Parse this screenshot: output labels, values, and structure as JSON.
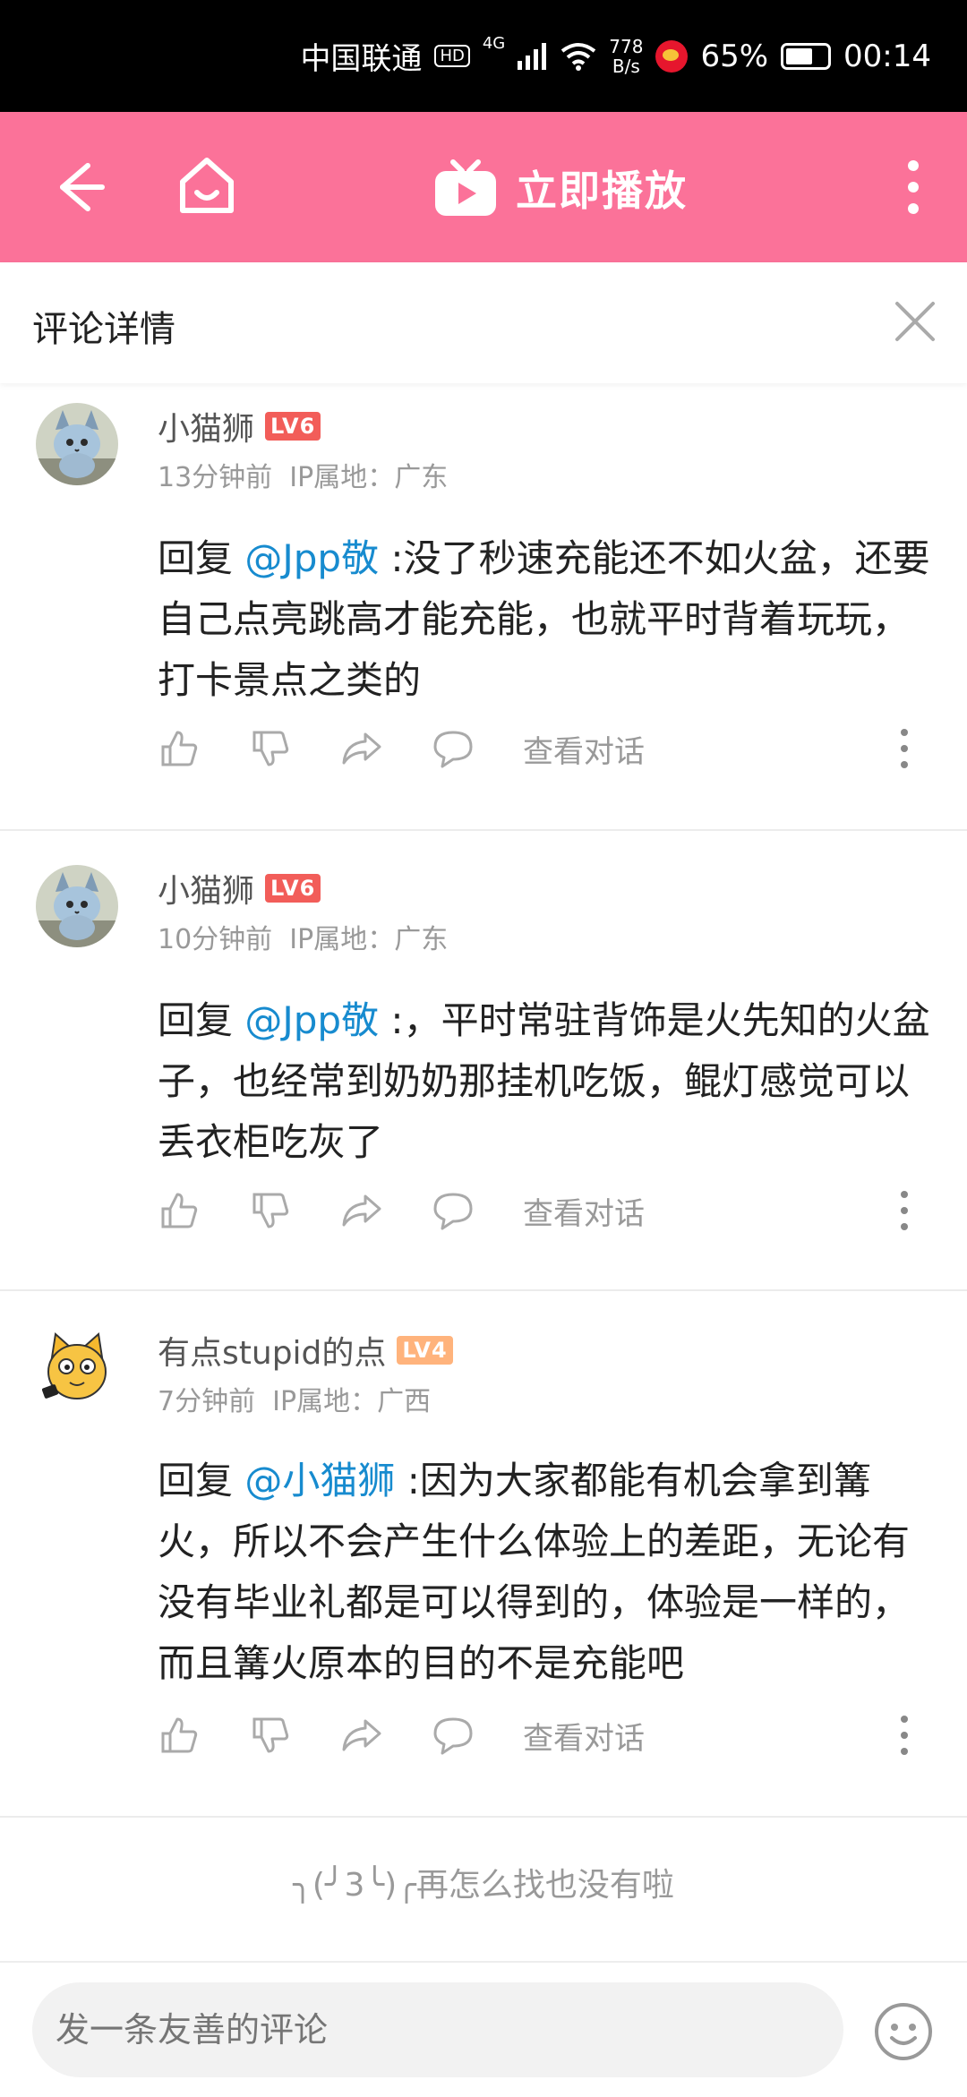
{
  "status_bar": {
    "carrier": "中国联通",
    "hd": "HD",
    "network": "4G",
    "speed_top": "778",
    "speed_bottom": "B/s",
    "battery": "65%",
    "battery_level": 0.65,
    "time": "00:14"
  },
  "app_bar": {
    "title": "立即播放",
    "accent_color": "#fb7299"
  },
  "detail": {
    "title": "评论详情"
  },
  "comments": [
    {
      "user": "小猫狮",
      "level": "LV6",
      "time": "13分钟前",
      "ip": "IP属地：广东",
      "reply_prefix": "回复 ",
      "mention": "@Jpp敬",
      "text": " :没了秒速充能还不如火盆，还要自己点亮跳高才能充能，也就平时背着玩玩，打卡景点之类的",
      "view_conversation": "查看对话"
    },
    {
      "user": "小猫狮",
      "level": "LV6",
      "time": "10分钟前",
      "ip": "IP属地：广东",
      "reply_prefix": "回复 ",
      "mention": "@Jpp敬",
      "text": " :，平时常驻背饰是火先知的火盆子，也经常到奶奶那挂机吃饭，鲲灯感觉可以丢衣柜吃灰了",
      "view_conversation": "查看对话"
    },
    {
      "user": "有点stupid的点",
      "level": "LV4",
      "time": "7分钟前",
      "ip": "IP属地：广西",
      "reply_prefix": "回复 ",
      "mention": "@小猫狮",
      "text": " :因为大家都能有机会拿到篝火，所以不会产生什么体验上的差距，无论有没有毕业礼都是可以得到的，体验是一样的，而且篝火原本的目的不是充能吧",
      "view_conversation": "查看对话"
    }
  ],
  "end_text": "╮(╯3╰)╭再怎么找也没有啦",
  "input": {
    "placeholder": "发一条友善的评论"
  }
}
